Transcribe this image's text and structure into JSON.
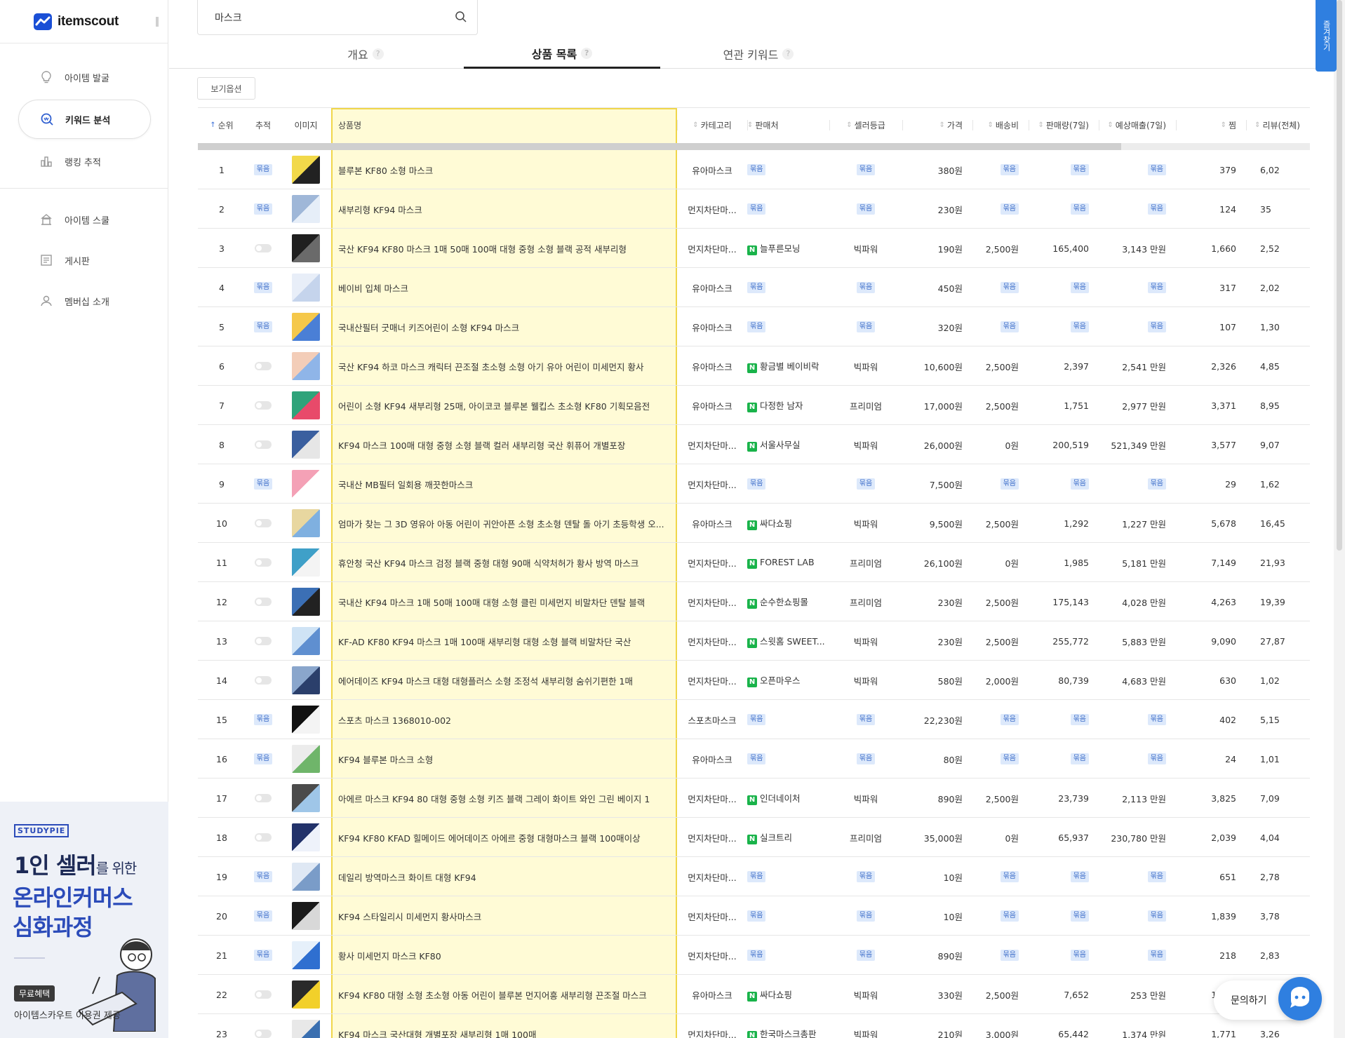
{
  "app": {
    "logo_text": "itemscout"
  },
  "sidebar": {
    "items": [
      {
        "label": "아이템 발굴",
        "icon": "lightbulb-icon",
        "active": false
      },
      {
        "label": "키워드 분석",
        "icon": "keyword-search-icon",
        "active": true
      },
      {
        "label": "랭킹 추적",
        "icon": "bar-chart-icon",
        "active": false
      }
    ],
    "items2": [
      {
        "label": "아이템 스쿨",
        "icon": "school-icon"
      },
      {
        "label": "게시판",
        "icon": "board-icon"
      },
      {
        "label": "멤버십 소개",
        "icon": "membership-icon"
      }
    ]
  },
  "ad": {
    "brand": "STUDYPIE",
    "line1_big": "1인 셀러",
    "line1_small": "를 위한",
    "line2": "온라인커머스",
    "line3": "심화과정",
    "badge": "무료혜택",
    "footer": "아이템스카우트 이용권 제공"
  },
  "search": {
    "value": "마스크",
    "icon": "search-icon"
  },
  "tabs": [
    {
      "label": "개요",
      "active": false
    },
    {
      "label": "상품 목록",
      "active": true
    },
    {
      "label": "연관 키워드",
      "active": false
    }
  ],
  "view_options_label": "보기옵션",
  "table": {
    "columns": [
      "순위",
      "추적",
      "이미지",
      "상품명",
      "카테고리",
      "판매처",
      "셀러등급",
      "가격",
      "배송비",
      "판매량(7일)",
      "예상매출(7일)",
      "찜",
      "리뷰(전체)"
    ],
    "tag_text": "묶음",
    "rows": [
      {
        "rank": "1",
        "track": "tag",
        "name": "블루본 KF80 소형 마스크",
        "category": "유아마스크",
        "seller": "",
        "grade": "",
        "price": "380원",
        "ship": "",
        "sales": "",
        "revenue": "",
        "wish": "379",
        "review": "6,02"
      },
      {
        "rank": "2",
        "track": "tag",
        "name": "새부리형 KF94 마스크",
        "category": "먼지차단마...",
        "seller": "",
        "grade": "",
        "price": "230원",
        "ship": "",
        "sales": "",
        "revenue": "",
        "wish": "124",
        "review": "35"
      },
      {
        "rank": "3",
        "track": "toggle",
        "name": "국산 KF94 KF80 마스크 1매 50매 100매 대형 중형 소형 블랙 공적 새부리형",
        "category": "먼지차단마...",
        "seller": "늘푸른모닝",
        "grade": "빅파워",
        "price": "190원",
        "ship": "2,500원",
        "sales": "165,400",
        "revenue": "3,143 만원",
        "wish": "1,660",
        "review": "2,52"
      },
      {
        "rank": "4",
        "track": "tag",
        "name": "베이비 입체 마스크",
        "category": "유아마스크",
        "seller": "",
        "grade": "",
        "price": "450원",
        "ship": "",
        "sales": "",
        "revenue": "",
        "wish": "317",
        "review": "2,02"
      },
      {
        "rank": "5",
        "track": "tag",
        "name": "국내산필터 굿매너 키즈어린이 소형 KF94 마스크",
        "category": "유아마스크",
        "seller": "",
        "grade": "",
        "price": "320원",
        "ship": "",
        "sales": "",
        "revenue": "",
        "wish": "107",
        "review": "1,30"
      },
      {
        "rank": "6",
        "track": "toggle",
        "name": "국산 KF94 하코 마스크 캐릭터 끈조절 초소형 소형 아기 유아 어린이 미세먼지 황사",
        "category": "유아마스크",
        "seller": "황금별 베이비락",
        "grade": "빅파워",
        "price": "10,600원",
        "ship": "2,500원",
        "sales": "2,397",
        "revenue": "2,541 만원",
        "wish": "2,326",
        "review": "4,85"
      },
      {
        "rank": "7",
        "track": "toggle",
        "name": "어린이 소형 KF94 새부리형 25매, 아이코코 블루본 웰킵스 초소형 KF80 기획모음전",
        "category": "유아마스크",
        "seller": "다정한 남자",
        "grade": "프리미엄",
        "price": "17,000원",
        "ship": "2,500원",
        "sales": "1,751",
        "revenue": "2,977 만원",
        "wish": "3,371",
        "review": "8,95"
      },
      {
        "rank": "8",
        "track": "toggle",
        "name": "KF94 마스크 100매 대형 중형 소형 블랙 컬러 새부리형 국산 휘퓨어 개별포장",
        "category": "먼지차단마...",
        "seller": "서울사무실",
        "grade": "빅파워",
        "price": "26,000원",
        "ship": "0원",
        "sales": "200,519",
        "revenue": "521,349 만원",
        "wish": "3,577",
        "review": "9,07"
      },
      {
        "rank": "9",
        "track": "tag",
        "name": "국내산 MB필터 일회용 깨끗한마스크",
        "category": "먼지차단마...",
        "seller": "",
        "grade": "",
        "price": "7,500원",
        "ship": "",
        "sales": "",
        "revenue": "",
        "wish": "29",
        "review": "1,62"
      },
      {
        "rank": "10",
        "track": "toggle",
        "name": "엄마가 찾는 그 3D 영유아 아동 어린이 귀안아픈 소형 초소형 덴탈 돌 아기 초등학생 오...",
        "category": "유아마스크",
        "seller": "싸다쇼핑",
        "grade": "빅파워",
        "price": "9,500원",
        "ship": "2,500원",
        "sales": "1,292",
        "revenue": "1,227 만원",
        "wish": "5,678",
        "review": "16,45"
      },
      {
        "rank": "11",
        "track": "toggle",
        "name": "휴안청 국산 KF94 마스크 검정 블랙 중형 대형 90매 식약처허가 황사 방역 마스크",
        "category": "먼지차단마...",
        "seller": "FOREST LAB",
        "grade": "프리미엄",
        "price": "26,100원",
        "ship": "0원",
        "sales": "1,985",
        "revenue": "5,181 만원",
        "wish": "7,149",
        "review": "21,93"
      },
      {
        "rank": "12",
        "track": "toggle",
        "name": "국내산 KF94 마스크 1매 50매 100매 대형 소형 클린 미세먼지 비말차단 덴탈 블랙",
        "category": "먼지차단마...",
        "seller": "순수한쇼핑몰",
        "grade": "프리미엄",
        "price": "230원",
        "ship": "2,500원",
        "sales": "175,143",
        "revenue": "4,028 만원",
        "wish": "4,263",
        "review": "19,39"
      },
      {
        "rank": "13",
        "track": "toggle",
        "name": "KF-AD KF80 KF94 마스크 1매 100매 새부리형 대형 소형 블랙 비말차단 국산",
        "category": "먼지차단마...",
        "seller": "스윗홈 SWEET...",
        "grade": "빅파워",
        "price": "230원",
        "ship": "2,500원",
        "sales": "255,772",
        "revenue": "5,883 만원",
        "wish": "9,090",
        "review": "27,87"
      },
      {
        "rank": "14",
        "track": "toggle",
        "name": "에어데이즈 KF94 마스크 대형 대형플러스 소형 조정석 새부리형 숨쉬기편한 1매",
        "category": "먼지차단마...",
        "seller": "오픈마우스",
        "grade": "빅파워",
        "price": "580원",
        "ship": "2,000원",
        "sales": "80,739",
        "revenue": "4,683 만원",
        "wish": "630",
        "review": "1,02"
      },
      {
        "rank": "15",
        "track": "tag",
        "name": "스포츠 마스크 1368010-002",
        "category": "스포츠마스크",
        "seller": "",
        "grade": "",
        "price": "22,230원",
        "ship": "",
        "sales": "",
        "revenue": "",
        "wish": "402",
        "review": "5,15"
      },
      {
        "rank": "16",
        "track": "tag",
        "name": "KF94 블루본 마스크 소형",
        "category": "유아마스크",
        "seller": "",
        "grade": "",
        "price": "80원",
        "ship": "",
        "sales": "",
        "revenue": "",
        "wish": "24",
        "review": "1,01"
      },
      {
        "rank": "17",
        "track": "toggle",
        "name": "아에르 마스크 KF94 80 대형 중형 소형 키즈 블랙 그레이 화이트 와인 그린 베이지 1",
        "category": "먼지차단마...",
        "seller": "인더네이처",
        "grade": "빅파워",
        "price": "890원",
        "ship": "2,500원",
        "sales": "23,739",
        "revenue": "2,113 만원",
        "wish": "3,825",
        "review": "7,09"
      },
      {
        "rank": "18",
        "track": "toggle",
        "name": "KF94 KF80 KFAD 힐메이드 에어데이즈 아에르 중형 대형마스크 블랙 100매이상",
        "category": "먼지차단마...",
        "seller": "실크트리",
        "grade": "프리미엄",
        "price": "35,000원",
        "ship": "0원",
        "sales": "65,937",
        "revenue": "230,780 만원",
        "wish": "2,039",
        "review": "4,04"
      },
      {
        "rank": "19",
        "track": "tag",
        "name": "데일리 방역마스크 화이트 대형 KF94",
        "category": "먼지차단마...",
        "seller": "",
        "grade": "",
        "price": "10원",
        "ship": "",
        "sales": "",
        "revenue": "",
        "wish": "651",
        "review": "2,78"
      },
      {
        "rank": "20",
        "track": "tag",
        "name": "KF94 스타일리시 미세먼지 황사마스크",
        "category": "먼지차단마...",
        "seller": "",
        "grade": "",
        "price": "10원",
        "ship": "",
        "sales": "",
        "revenue": "",
        "wish": "1,839",
        "review": "3,78"
      },
      {
        "rank": "21",
        "track": "tag",
        "name": "황사 미세먼지 마스크 KF80",
        "category": "먼지차단마...",
        "seller": "",
        "grade": "",
        "price": "890원",
        "ship": "",
        "sales": "",
        "revenue": "",
        "wish": "218",
        "review": "2,83"
      },
      {
        "rank": "22",
        "track": "toggle",
        "name": "KF94 KF80 대형 소형 초소형 아동 어린이 블루본 먼지어흥 새부리형 끈조절 마스크",
        "category": "유아마스크",
        "seller": "싸다쇼핑",
        "grade": "빅파워",
        "price": "330원",
        "ship": "2,500원",
        "sales": "7,652",
        "revenue": "253 만원",
        "wish": "1,839",
        "review": "3,08"
      },
      {
        "rank": "23",
        "track": "toggle",
        "name": "KF94 마스크 국산대형 개별포장 새부리형 1매 100매",
        "category": "먼지차단마...",
        "seller": "한국마스크총판",
        "grade": "빅파워",
        "price": "210원",
        "ship": "3,000원",
        "sales": "65,442",
        "revenue": "1,374 만원",
        "wish": "1,771",
        "review": "3,26"
      }
    ]
  },
  "side_tab_label": "즐겨찾기",
  "chat": {
    "label": "문의하기"
  },
  "colors": {
    "accent": "#2f7fe0",
    "highlight": "#fffbd6",
    "tag_bg": "#dde9fb",
    "tag_fg": "#3b6cc8",
    "naver_green": "#19b34a"
  }
}
